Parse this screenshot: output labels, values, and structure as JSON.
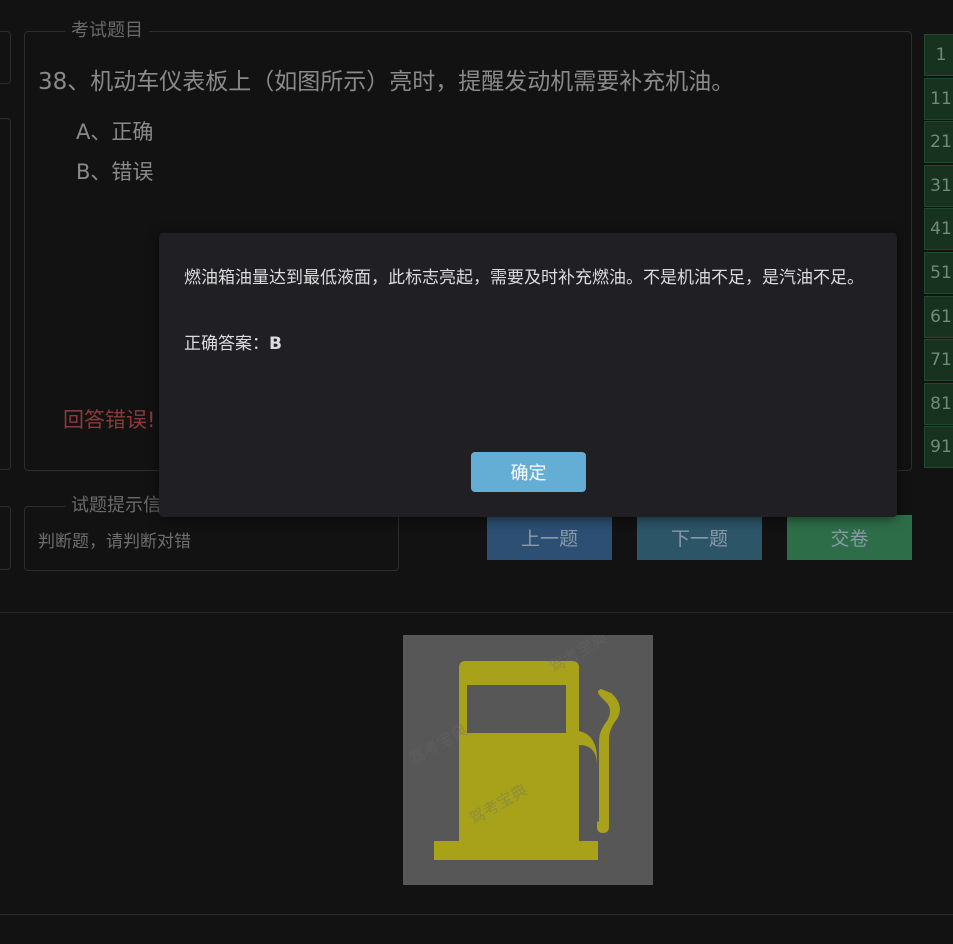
{
  "question_panel": {
    "legend": "考试题目",
    "question": "38、机动车仪表板上（如图所示）亮时，提醒发动机需要补充机油。",
    "options": [
      "A、正确",
      "B、错误"
    ],
    "result": "回答错误!"
  },
  "hint_panel": {
    "legend": "试题提示信",
    "text": "判断题，请判断对错"
  },
  "nav": {
    "prev": "上一题",
    "next": "下一题",
    "submit": "交卷"
  },
  "question_numbers": [
    "1",
    "11",
    "21",
    "31",
    "41",
    "51",
    "61",
    "71",
    "81",
    "91"
  ],
  "modal": {
    "explanation": "燃油箱油量达到最低液面，此标志亮起，需要及时补充燃油。不是机油不足，是汽油不足。",
    "answer_label": "正确答案：",
    "answer_value": "B",
    "ok": "确定"
  },
  "image": {
    "icon": "fuel-pump-warning-icon",
    "icon_color": "#a8a21a",
    "background": "#575757"
  },
  "colors": {
    "page_bg": "#121212",
    "modal_bg": "#1f1f24",
    "ok_button": "#64aed6",
    "prev_button": "#2c4f73",
    "next_button": "#2c5568",
    "submit_button": "#2d6e48",
    "wrong_text": "#8a3a3a"
  }
}
